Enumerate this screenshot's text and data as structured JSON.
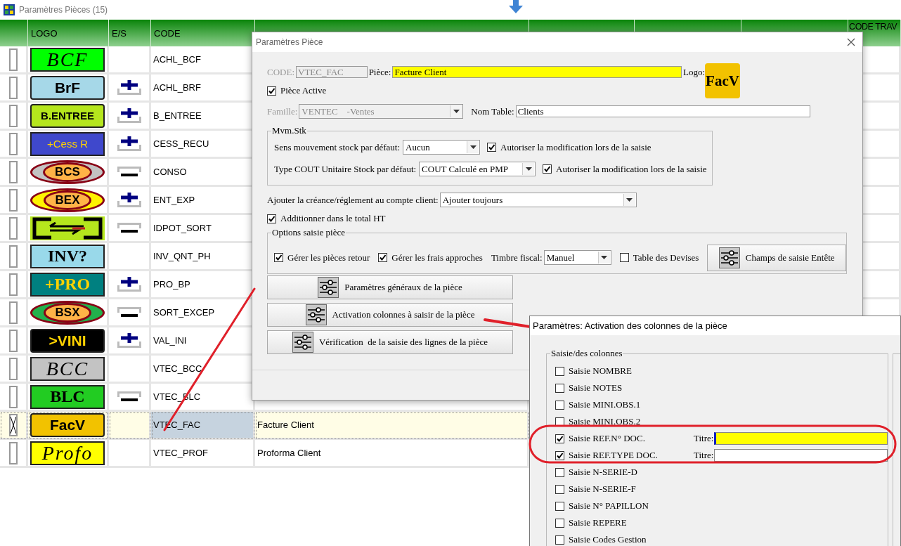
{
  "window": {
    "title": "Paramètres Pièces (15)"
  },
  "table": {
    "columns": [
      "LOGO",
      "E/S",
      "CODE"
    ],
    "last_column": "CODE TRAV",
    "rows": [
      {
        "checked": false,
        "selected": false,
        "logo": {
          "text": "BCF",
          "kind": "script",
          "color": "#00ff00"
        },
        "code": "ACHL_BCF"
      },
      {
        "checked": false,
        "selected": false,
        "logo": {
          "text": "BrF",
          "kind": "bold",
          "color": "#a6d8e8"
        },
        "es": {
          "kind": "plus"
        },
        "code": "ACHL_BRF"
      },
      {
        "checked": false,
        "selected": false,
        "logo": {
          "text": "B.ENTREE",
          "kind": "bold",
          "color": "#b5e61d"
        },
        "es": {
          "kind": "plus"
        },
        "code": "B_ENTREE"
      },
      {
        "checked": false,
        "selected": false,
        "logo": {
          "text": "+Cess R",
          "kind": "sans",
          "color": "#3f48cc"
        },
        "es": {
          "kind": "plus"
        },
        "code": "CESS_RECU"
      },
      {
        "checked": false,
        "selected": false,
        "logo": {
          "text": "BCS",
          "kind": "oval",
          "color": "#c3c3c3"
        },
        "es": {
          "kind": "minus"
        },
        "code": "CONSO"
      },
      {
        "checked": false,
        "selected": false,
        "logo": {
          "text": "BEX",
          "kind": "oval",
          "color": "#fff200"
        },
        "es": {
          "kind": "plus"
        },
        "code": "ENT_EXP"
      },
      {
        "checked": false,
        "selected": false,
        "logo": {
          "kind": "arrows",
          "color": "#b5e61d"
        },
        "es": {
          "kind": "minus"
        },
        "code": "IDPOT_SORT"
      },
      {
        "checked": false,
        "selected": false,
        "logo": {
          "text": "INV?",
          "kind": "serif",
          "color": "#99d9ea"
        },
        "code": "INV_QNT_PH"
      },
      {
        "checked": false,
        "selected": false,
        "logo": {
          "text": "+PRO",
          "kind": "serif",
          "color": "#008080"
        },
        "es": {
          "kind": "plus"
        },
        "code": "PRO_BP"
      },
      {
        "checked": false,
        "selected": false,
        "logo": {
          "text": "BSX",
          "kind": "oval",
          "color": "#22b14c"
        },
        "es": {
          "kind": "minus"
        },
        "code": "SORT_EXCEP"
      },
      {
        "checked": false,
        "selected": false,
        "logo": {
          "text": ">VINI",
          "kind": "bold",
          "color": "#000000"
        },
        "es": {
          "kind": "plus"
        },
        "code": "VAL_INI"
      },
      {
        "checked": false,
        "selected": false,
        "logo": {
          "text": "BCC",
          "kind": "script",
          "color": "#c3c3c3"
        },
        "code": "VTEC_BCC"
      },
      {
        "checked": false,
        "selected": false,
        "logo": {
          "text": "BLC",
          "kind": "serif",
          "color": "#22cc22"
        },
        "es": {
          "kind": "minus"
        },
        "code": "VTEC_BLC"
      },
      {
        "checked": true,
        "selected": true,
        "logo": {
          "text": "FacV",
          "kind": "bold",
          "color": "#f2c200"
        },
        "code": "VTEC_FAC",
        "piece": "Facture Client"
      },
      {
        "checked": false,
        "selected": false,
        "logo": {
          "text": "Profo",
          "kind": "script",
          "color": "#ffff00"
        },
        "code": "VTEC_PROF",
        "piece": "Proforma Client"
      }
    ]
  },
  "piece_dialog": {
    "title": "Paramètres Pièce",
    "code_label": "CODE:",
    "code": "VTEC_FAC",
    "piece_label": "Pièce:",
    "piece": "Facture Client",
    "logo_label": "Logo:",
    "logo": {
      "text": "FacV",
      "kind": "bold",
      "color": "#f2c200"
    },
    "active": {
      "label": "Pièce Active",
      "checked": true
    },
    "famille_label": "Famille:",
    "famille": "VENTEC    -Ventes",
    "table_label": "Nom Table:",
    "table": "Clients",
    "stock_group": {
      "title": "Mvm.Stk",
      "rows": [
        {
          "label": "Sens mouvement stock par défaut:",
          "value": "Aucun",
          "allow": {
            "label": "Autoriser la modification lors de la saisie",
            "checked": true
          }
        },
        {
          "label": "Type COUT Unitaire Stock par défaut:",
          "value": "COUT Calculé en PMP",
          "allow": {
            "label": "Autoriser la modification lors de la saisie",
            "checked": true
          }
        }
      ]
    },
    "credit": {
      "label": "Ajouter la créance/réglement au compte client:",
      "value": "Ajouter toujours"
    },
    "total_ht": {
      "label": "Additionner dans le total HT",
      "checked": true
    },
    "options_group": {
      "title": "Options saisie pièce",
      "returns": {
        "label": "Gérer les pièces retour",
        "checked": true
      },
      "fees": {
        "label": "Gérer les frais approches",
        "checked": true
      },
      "stamp_label": "Timbre fiscal:",
      "stamp": "Manuel",
      "currencies": {
        "label": "Table des Devises",
        "checked": false
      },
      "header_button": "Champs de saisie Entête"
    },
    "buttons": [
      "Paramètres généraux de la pièce",
      "Activation colonnes à saisir de la pièce",
      "Vérification  de la saisie des lignes de la pièce"
    ]
  },
  "columns_dialog": {
    "title": "Paramètres: Activation des colonnes de la pièce",
    "group": "Saisie/des colonnes",
    "items": [
      {
        "kind": "plain",
        "label": "Saisie NOMBRE",
        "checked": false
      },
      {
        "kind": "plain",
        "label": "Saisie NOTES",
        "checked": false
      },
      {
        "kind": "plain",
        "label": "Saisie MINI.OBS.1",
        "checked": false
      },
      {
        "kind": "plain",
        "label": "Saisie MINI.OBS.2",
        "checked": false
      },
      {
        "kind": "titled",
        "label": "Saisie REF.N° DOC.",
        "checked": true,
        "title_label": "Titre:",
        "focused": true
      },
      {
        "kind": "titled",
        "label": "Saisie REF.TYPE DOC.",
        "checked": true,
        "title_label": "Titre:",
        "focused": false
      },
      {
        "kind": "plain",
        "label": "Saisie N-SERIE-D",
        "checked": false
      },
      {
        "kind": "plain",
        "label": "Saisie N-SERIE-F",
        "checked": false
      },
      {
        "kind": "plain",
        "label": "Saisie N° PAPILLON",
        "checked": false
      },
      {
        "kind": "plain",
        "label": "Saisie REPERE",
        "checked": false
      },
      {
        "kind": "plain",
        "label": "Saisie Codes Gestion",
        "checked": false
      }
    ]
  }
}
